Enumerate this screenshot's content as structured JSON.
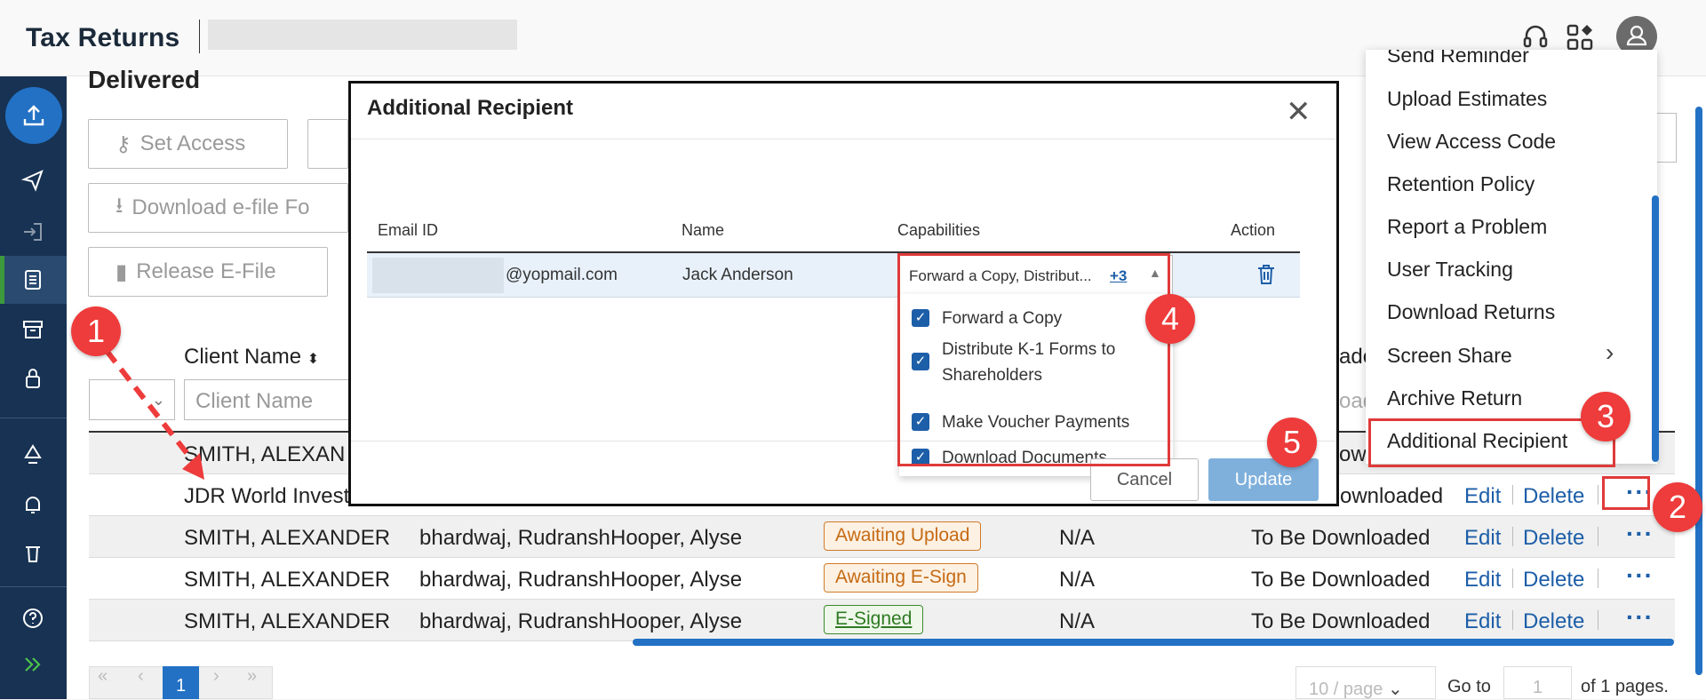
{
  "header": {
    "app_title": "Tax Returns"
  },
  "sidebar": {
    "items": [
      {
        "icon": "upload-icon"
      },
      {
        "icon": "send-icon"
      },
      {
        "icon": "sign-in-icon"
      },
      {
        "icon": "document-icon"
      },
      {
        "icon": "archive-icon"
      },
      {
        "icon": "lock-icon"
      },
      {
        "icon": "recycle-icon"
      },
      {
        "icon": "bell-icon"
      },
      {
        "icon": "trash-icon"
      },
      {
        "icon": "help-icon"
      },
      {
        "icon": "expand-icon"
      }
    ]
  },
  "page": {
    "heading": "Delivered",
    "toolbar": {
      "set_access": "Set Access",
      "download_efile": "Download e-file Fo",
      "release_efile": "Release E-File"
    },
    "filters": {
      "column_header": "Client Name",
      "client_name_placeholder": "Client Name"
    }
  },
  "table": {
    "rows": [
      {
        "client": "SMITH, ALEXAN",
        "partial": true,
        "partner": "",
        "assigned": "",
        "status": "",
        "status_style": "",
        "signed": "",
        "download": "",
        "edit": "",
        "delete": ""
      },
      {
        "client": "JDR World Invest",
        "partial": true,
        "partner": "",
        "assigned": "",
        "status": "",
        "status_style": "",
        "signed": "",
        "download": "ownloaded",
        "edit": "Edit",
        "delete": "Delete"
      },
      {
        "client": "SMITH, ALEXANDER",
        "partner": "bhardwaj, Rudransh",
        "assigned": "Hooper, Alyse",
        "status": "Awaiting Upload",
        "status_style": "orange",
        "signed": "N/A",
        "download": "To Be Downloaded",
        "edit": "Edit",
        "delete": "Delete"
      },
      {
        "client": "SMITH, ALEXANDER",
        "partner": "bhardwaj, Rudransh",
        "assigned": "Hooper, Alyse",
        "status": "Awaiting E-Sign",
        "status_style": "orange",
        "signed": "N/A",
        "download": "To Be Downloaded",
        "edit": "Edit",
        "delete": "Delete"
      },
      {
        "client": "SMITH, ALEXANDER",
        "partner": "bhardwaj, Rudransh",
        "assigned": "Hooper, Alyse",
        "status": "E-Signed",
        "status_style": "green",
        "signed": "N/A",
        "download": "To Be Downloaded",
        "edit": "Edit",
        "delete": "Delete"
      }
    ],
    "partial_column_texts": [
      "ade",
      "oad",
      "ownl"
    ]
  },
  "pagination": {
    "current_page": "1",
    "page_size": "10 / page",
    "goto_label": "Go to",
    "goto_value": "1",
    "total_label": "of 1 pages."
  },
  "modal": {
    "title": "Additional Recipient",
    "columns": {
      "email": "Email ID",
      "name": "Name",
      "capabilities": "Capabilities",
      "action": "Action"
    },
    "recipient": {
      "email": "@yopmail.com",
      "name": "Jack Anderson",
      "capabilities_summary": "Forward a Copy, Distribut...",
      "more_count": "+3"
    },
    "capabilities_options": [
      {
        "label": "Forward a Copy",
        "checked": true
      },
      {
        "label": "Distribute K-1 Forms to Shareholders",
        "checked": true
      },
      {
        "label": "Make Voucher Payments",
        "checked": true
      },
      {
        "label": "Download Documents",
        "checked": true
      }
    ],
    "cancel_label": "Cancel",
    "update_label": "Update"
  },
  "context_menu": {
    "items": [
      "Send Reminder",
      "Upload Estimates",
      "View Access Code",
      "Retention Policy",
      "Report a Problem",
      "User Tracking",
      "Download Returns",
      "Screen Share",
      "Archive Return",
      "Additional Recipient"
    ]
  },
  "annotations": {
    "markers": [
      "1",
      "2",
      "3",
      "4",
      "5"
    ],
    "color": "#ee3b3b"
  },
  "colors": {
    "sidebar": "#173253",
    "accent": "#2371c4",
    "link": "#1d5ea8"
  }
}
